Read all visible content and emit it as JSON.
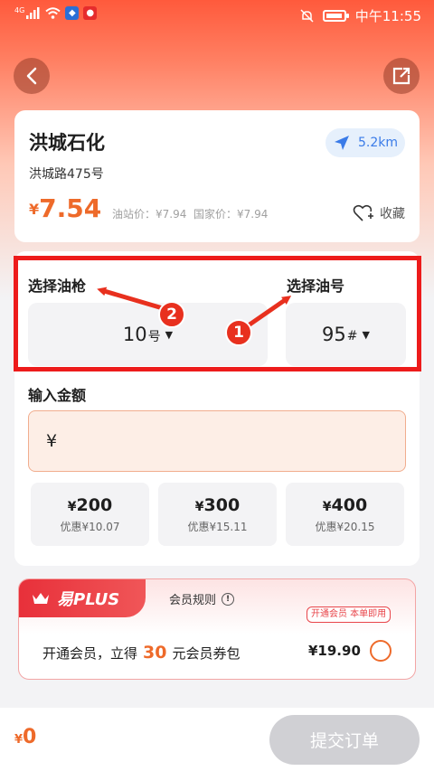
{
  "status_bar": {
    "network": "4G",
    "time": "中午11:55"
  },
  "station": {
    "name": "洪城石化",
    "address": "洪城路475号",
    "distance": "5.2km",
    "price_currency": "¥",
    "price": "7.54",
    "station_price": "油站价：¥7.94",
    "national_price": "国家价：¥7.94",
    "favorite_label": "收藏"
  },
  "selection": {
    "gun_label": "选择油枪",
    "gun_value": "10",
    "gun_suffix": "号",
    "fuel_label": "选择油号",
    "fuel_value": "95",
    "fuel_suffix": "#",
    "badge_1": "1",
    "badge_2": "2"
  },
  "amount": {
    "label": "输入金额",
    "placeholder": "¥",
    "quick_options": [
      {
        "currency": "¥",
        "amount": "200",
        "discount": "优惠¥10.07"
      },
      {
        "currency": "¥",
        "amount": "300",
        "discount": "优惠¥15.11"
      },
      {
        "currency": "¥",
        "amount": "400",
        "discount": "优惠¥20.15"
      }
    ]
  },
  "membership": {
    "brand": "易PLUS",
    "rules_label": "会员规则",
    "badge": "开通会员 本单即用",
    "desc_prefix": "开通会员，立得",
    "desc_highlight": "30",
    "desc_suffix": "元会员券包",
    "price": "¥19.90"
  },
  "footer": {
    "total_currency": "¥",
    "total": "0",
    "submit_label": "提交订单"
  },
  "colors": {
    "accent": "#ee6a2a",
    "annotation": "#e8301e",
    "link_blue": "#3a7be8"
  }
}
